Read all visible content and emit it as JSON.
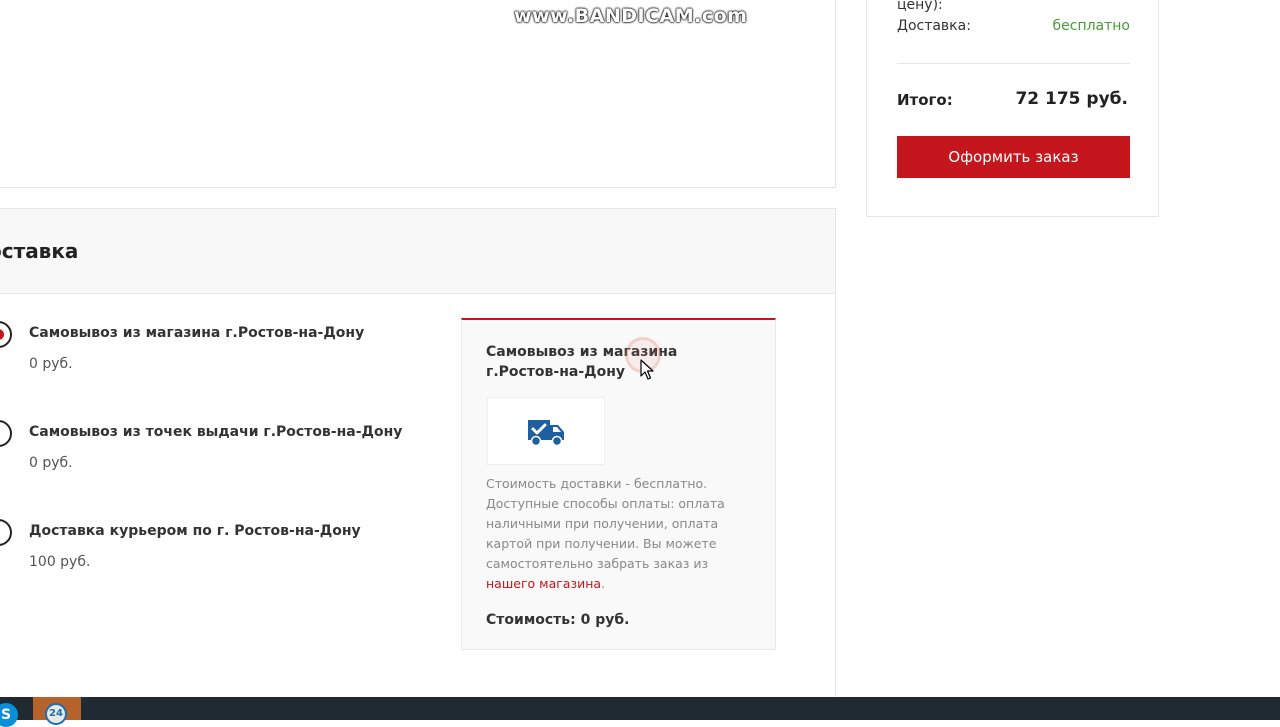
{
  "watermark": "www.BANDICAM.com",
  "summary": {
    "price_note": "цену):",
    "delivery_label": "Доставка:",
    "delivery_value": "бесплатно",
    "total_label": "Итого:",
    "total_value": "72 175 руб.",
    "order_button": "Оформить заказ"
  },
  "delivery": {
    "title": "оставка",
    "options": [
      {
        "name": "Самовывоз из магазина г.Ростов-на-Дону",
        "price": "0 руб.",
        "selected": true
      },
      {
        "name": "Самовывоз из точек выдачи г.Ростов-на-Дону",
        "price": "0 руб.",
        "selected": false
      },
      {
        "name": "Доставка курьером по г. Ростов-на-Дону",
        "price": "100 руб.",
        "selected": false
      }
    ],
    "info": {
      "title": "Самовывоз из магазина г.Ростов-на-Дону",
      "image_icon": "delivery-truck-check-icon",
      "description": "Стоимость доставки - бесплатно. Доступные способы оплаты: оплата наличными при получении, оплата картой при получении. Вы можете самостоятельно забрать заказ из",
      "link_text": "нашего магазина",
      "link_suffix": ".",
      "cost": "Стоимость: 0 руб."
    }
  },
  "taskbar": {
    "skype_glyph": "S",
    "app_glyph": "24"
  },
  "colors": {
    "accent": "#c4161c",
    "green": "#4a9a3a",
    "taskbar": "#1f2a33"
  }
}
